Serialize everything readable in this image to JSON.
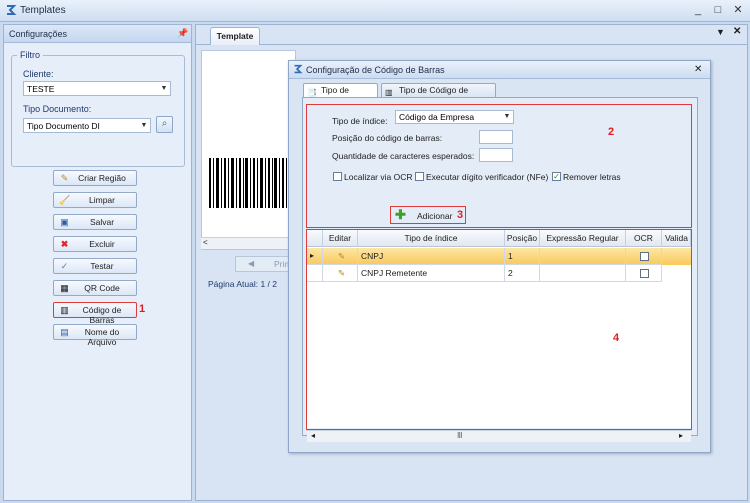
{
  "window": {
    "title": "Templates",
    "controls": [
      "_",
      "□",
      "✕"
    ]
  },
  "left_panel": {
    "header": "Configurações",
    "filtro_label": "Filtro",
    "cliente_label": "Cliente:",
    "cliente_value": "TESTE",
    "tipo_documento_label": "Tipo Documento:",
    "tipo_documento_value": "Tipo Documento DI",
    "buttons": [
      {
        "label": "Criar Região",
        "icon": "pencil-icon"
      },
      {
        "label": "Limpar",
        "icon": "broom-icon"
      },
      {
        "label": "Salvar",
        "icon": "floppy-icon"
      },
      {
        "label": "Excluir",
        "icon": "delete-x-icon"
      },
      {
        "label": "Testar",
        "icon": "test-icon"
      },
      {
        "label": "QR Code",
        "icon": "qrcode-icon"
      },
      {
        "label": "Código de Barras",
        "icon": "barcode-icon"
      },
      {
        "label": "Nome do Arquivo",
        "icon": "file-icon"
      }
    ],
    "marker_1": "1"
  },
  "main": {
    "tab_label": "Template",
    "nav_button_label": "Prin",
    "page_info": "Página Atual:  1 / 2"
  },
  "dialog": {
    "title": "Configuração de Código de Barras",
    "tabs": [
      "Tipo de Índices",
      "Tipo de Código de Barras"
    ],
    "tipo_indice_label": "Tipo de índice:",
    "tipo_indice_value": "Código da Empresa",
    "posicao_label": "Posição do código de barras:",
    "quantidade_label": "Quantidade de caracteres esperados:",
    "checkboxes": [
      {
        "label": "Localizar via OCR",
        "checked": false
      },
      {
        "label": "Executar dígito verificador (NFe)",
        "checked": false
      },
      {
        "label": "Remover letras",
        "checked": true
      }
    ],
    "add_button_label": "Adicionar",
    "marker_2": "2",
    "marker_3": "3",
    "marker_4": "4",
    "grid": {
      "columns": [
        "Editar",
        "Tipo de índice",
        "Posição",
        "Expressão Regular",
        "OCR",
        "Valida"
      ],
      "rows": [
        {
          "tipo": "CNPJ",
          "posicao": "1",
          "expressao": "",
          "ocr": false,
          "selected": true
        },
        {
          "tipo": "CNPJ Remetente",
          "posicao": "2",
          "expressao": "",
          "ocr": false,
          "selected": false
        }
      ],
      "row_indicator": "▸",
      "scroll_thumb": "Ⅲ"
    }
  },
  "colors": {
    "accent": "#e01e1e",
    "selected_row": "#f9c95c",
    "panel_bg": "#e6eef9"
  }
}
